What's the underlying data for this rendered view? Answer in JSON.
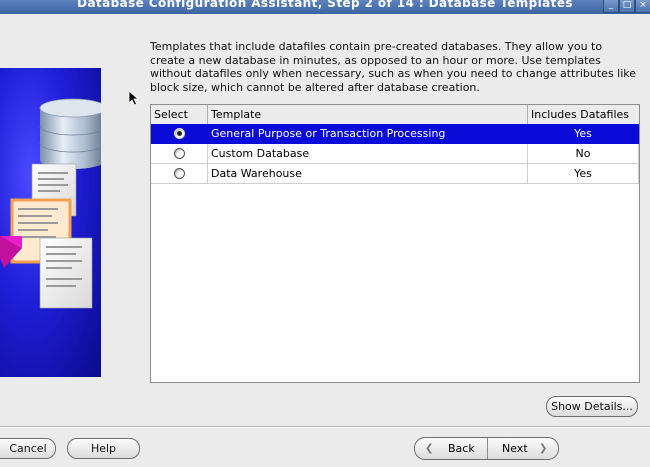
{
  "window": {
    "title": "Database Configuration Assistant, Step 2 of 14 : Database Templates"
  },
  "description": "Templates that include datafiles contain pre-created databases. They allow you to create a new database in minutes, as opposed to an hour or more. Use templates without datafiles only when necessary, such as when you need to change attributes like block size, which cannot be altered after database creation.",
  "table": {
    "headers": [
      "Select",
      "Template",
      "Includes Datafiles"
    ],
    "rows": [
      {
        "template": "General Purpose or Transaction Processing",
        "datafiles": "Yes",
        "selected": true
      },
      {
        "template": "Custom Database",
        "datafiles": "No",
        "selected": false
      },
      {
        "template": "Data Warehouse",
        "datafiles": "Yes",
        "selected": false
      }
    ]
  },
  "buttons": {
    "show_details": "Show Details...",
    "cancel": "Cancel",
    "help": "Help",
    "back": "Back",
    "next": "Next"
  },
  "colors": {
    "selection": "#0b0bd9",
    "titlebar": "#3a63a2"
  }
}
